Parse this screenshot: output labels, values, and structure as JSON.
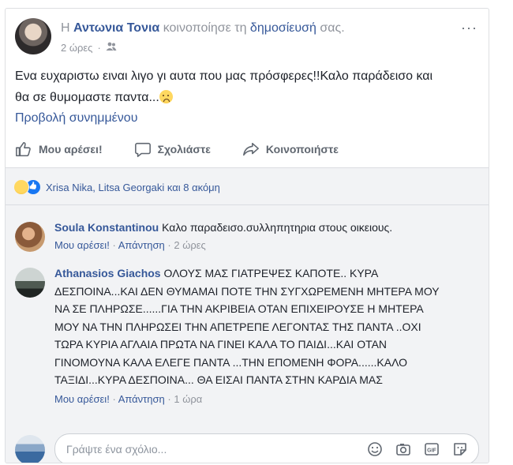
{
  "post": {
    "header": {
      "prefix": "Η",
      "author": "Αντωνια Τονια",
      "action_text": "κοινοποίησε τη",
      "object_link": "δημοσίευσή",
      "suffix": "σας.",
      "time": "2 ώρες",
      "audience_icon": "friends-icon",
      "more_label": "···"
    },
    "text_line1": "Ενα ευχαριστω ειναι λιγο γι αυτα που μας πρόσφερες!!Καλο παράδεισο και",
    "text_line2": "θα σε θυμομαστε παντα...",
    "emoji": "sad-face-emoji",
    "attachment_link": "Προβολή συνημμένου",
    "actions": {
      "like": "Μου αρέσει!",
      "comment": "Σχολιάστε",
      "share": "Κοινοποιήστε"
    },
    "reactions": {
      "icons": [
        "sad-reaction-icon",
        "like-reaction-icon"
      ],
      "summary": "Xrisa Nika, Litsa Georgaki και 8 ακόμη"
    }
  },
  "comments": [
    {
      "author": "Soula Konstantinou",
      "text": "Καλο παραδεισο.συλληπητηρια στους οικειους.",
      "like": "Μου αρέσει!",
      "reply": "Απάντηση",
      "time": "2 ώρες"
    },
    {
      "author": "Athanasios Giachos",
      "text": "ΟΛΟΥΣ ΜΑΣ ΓΙΑΤΡΕΨΕΣ ΚΑΠΟΤΕ.. ΚΥΡΑ ΔΕΣΠΟΙΝΑ...ΚΑΙ ΔΕΝ ΘΥΜΑΜΑΙ ΠΟΤΕ ΤΗΝ ΣΥΓΧΩΡΕΜΕΝΗ ΜΗΤΕΡΑ ΜΟΥ ΝΑ ΣΕ ΠΛΗΡΩΣΕ......ΓΙΑ ΤΗΝ ΑΚΡΙΒΕΙΑ ΟΤΑΝ ΕΠΙΧΕΙΡΟΥΣΕ Η ΜΗΤΕΡΑ ΜΟΥ ΝΑ ΤΗΝ ΠΛΗΡΩΣΕΙ ΤΗΝ ΑΠΕΤΡΕΠΕ ΛΕΓΟΝΤΑΣ ΤΗΣ ΠΑΝΤΑ ..ΟΧΙ ΤΩΡΑ ΚΥΡΙΑ ΑΓΛΑΙΑ ΠΡΩΤΑ ΝΑ ΓΙΝΕΙ ΚΑΛΑ ΤΟ ΠΑΙΔΙ...ΚΑΙ ΟΤΑΝ ΓΙΝΟΜΟΥΝΑ ΚΑΛΑ ΕΛΕΓΕ ΠΑΝΤΑ ...ΤΗΝ ΕΠΟΜΕΝΗ ΦΟΡΑ......ΚΑΛΟ ΤΑΞΙΔΙ...ΚΥΡΑ ΔΕΣΠΟΙΝΑ... ΘΑ ΕΙΣΑΙ ΠΑΝΤΑ ΣΤΗΝ ΚΑΡΔΙΑ ΜΑΣ",
      "like": "Μου αρέσει!",
      "reply": "Απάντηση",
      "time": "1 ώρα"
    }
  ],
  "composer": {
    "placeholder": "Γράψτε ένα σχόλιο...",
    "icons": [
      "emoji-icon",
      "camera-icon",
      "gif-icon",
      "sticker-icon"
    ]
  },
  "colors": {
    "link": "#365899",
    "meta": "#90949c",
    "text": "#1d2129",
    "comment_bg": "#f2f3f5",
    "like_blue": "#1877f2"
  }
}
